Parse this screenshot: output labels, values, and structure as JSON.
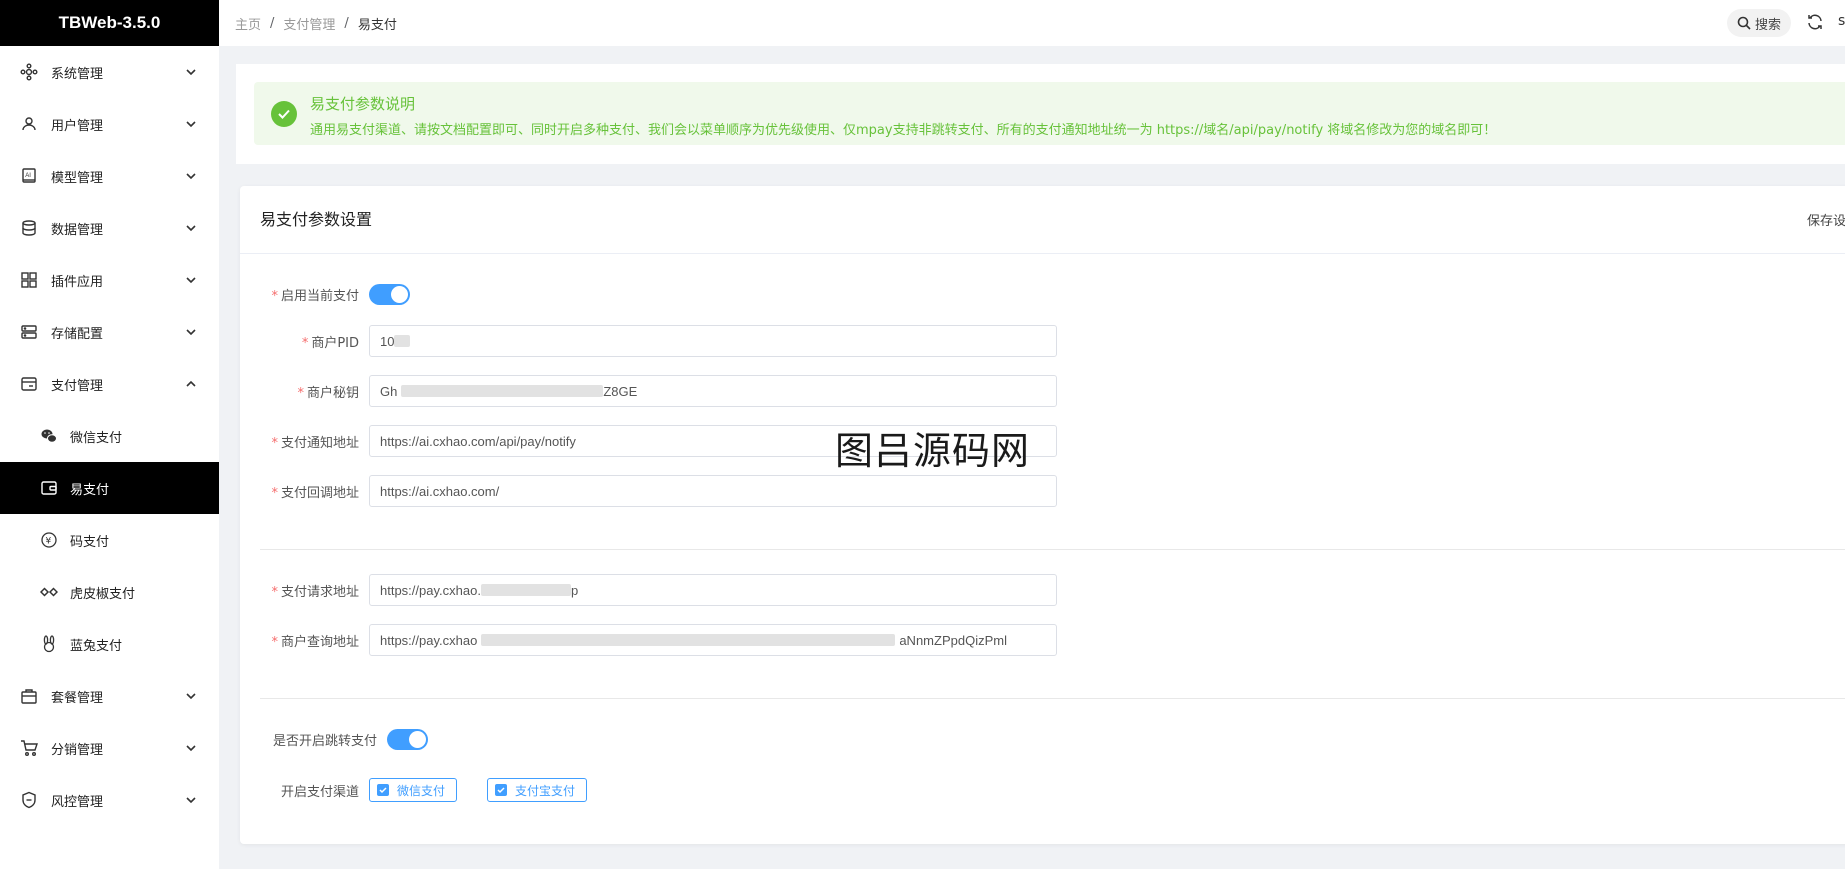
{
  "app": {
    "title": "TBWeb-3.5.0"
  },
  "sidebar": {
    "items": [
      {
        "label": "系统管理",
        "icon": "system-icon"
      },
      {
        "label": "用户管理",
        "icon": "user-icon"
      },
      {
        "label": "模型管理",
        "icon": "ai-model-icon"
      },
      {
        "label": "数据管理",
        "icon": "database-icon"
      },
      {
        "label": "插件应用",
        "icon": "apps-icon"
      },
      {
        "label": "存储配置",
        "icon": "storage-icon"
      },
      {
        "label": "支付管理",
        "icon": "payment-icon",
        "expanded": true
      },
      {
        "label": "套餐管理",
        "icon": "package-icon"
      },
      {
        "label": "分销管理",
        "icon": "distribution-icon"
      },
      {
        "label": "风控管理",
        "icon": "risk-control-icon"
      }
    ],
    "payment_sub": [
      {
        "label": "微信支付",
        "icon": "wechat-icon"
      },
      {
        "label": "易支付",
        "icon": "wallet-icon",
        "active": true
      },
      {
        "label": "码支付",
        "icon": "yuan-icon"
      },
      {
        "label": "虎皮椒支付",
        "icon": "diamond-link-icon"
      },
      {
        "label": "蓝兔支付",
        "icon": "rabbit-icon"
      }
    ]
  },
  "breadcrumb": [
    "主页",
    "支付管理",
    "易支付"
  ],
  "header": {
    "search_label": "搜索",
    "user_initial": "s"
  },
  "alert": {
    "title": "易支付参数说明",
    "desc": "通用易支付渠道、请按文档配置即可、同时开启多种支付、我们会以菜单顺序为优先级使用、仅mpay支持非跳转支付、所有的支付通知地址统一为 https://域名/api/pay/notify 将域名修改为您的域名即可！"
  },
  "card": {
    "title": "易支付参数设置",
    "save_label": "保存设"
  },
  "form": {
    "enable_label": "启用当前支付",
    "enable_value": true,
    "pid_label": "商户PID",
    "pid_value": "10",
    "secret_label": "商户秘钥",
    "secret_prefix": "Gh",
    "secret_suffix": "Z8GE",
    "notify_label": "支付通知地址",
    "notify_value": "https://ai.cxhao.com/api/pay/notify",
    "return_label": "支付回调地址",
    "return_value": "https://ai.cxhao.com/",
    "request_label": "支付请求地址",
    "request_prefix": "https://pay.cxhao.",
    "request_suffix": "p",
    "query_label": "商户查询地址",
    "query_prefix": "https://pay.cxhao",
    "query_suffix": "aNnmZPpdQizPml",
    "redirect_label": "是否开启跳转支付",
    "redirect_value": true,
    "channels_label": "开启支付渠道",
    "channels": [
      "微信支付",
      "支付宝支付"
    ]
  },
  "watermark": "图吕源码网",
  "colors": {
    "accent": "#409eff",
    "success": "#67c23a",
    "sidebar_active": "#000000"
  }
}
